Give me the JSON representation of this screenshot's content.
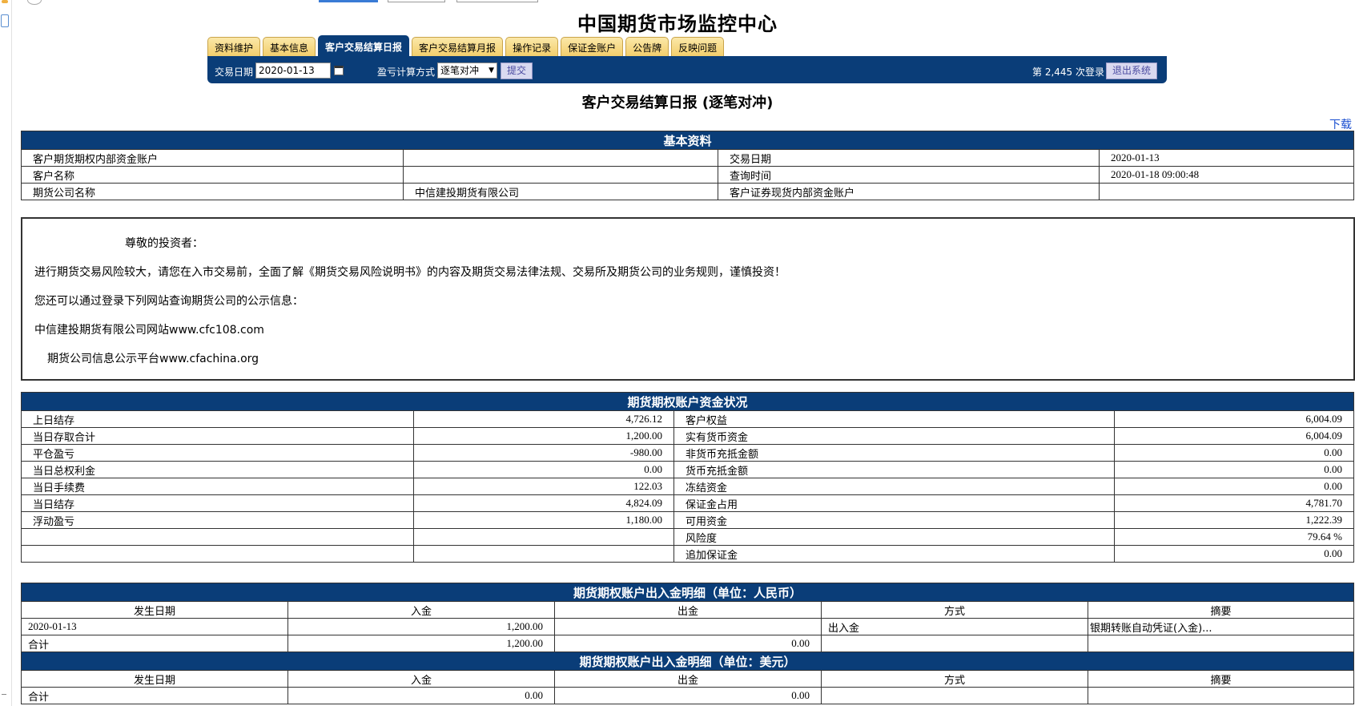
{
  "site_title": "中国期货市场监控中心",
  "tabs": [
    {
      "label": "资料维护",
      "active": false
    },
    {
      "label": "基本信息",
      "active": false
    },
    {
      "label": "客户交易结算日报",
      "active": true
    },
    {
      "label": "客户交易结算月报",
      "active": false
    },
    {
      "label": "操作记录",
      "active": false
    },
    {
      "label": "保证金账户",
      "active": false
    },
    {
      "label": "公告牌",
      "active": false
    },
    {
      "label": "反映问题",
      "active": false
    }
  ],
  "toolbar": {
    "date_label": "交易日期",
    "date_value": "2020-01-13",
    "method_label": "盈亏计算方式",
    "method_value": "逐笔对冲",
    "submit_label": "提交",
    "login_count": "第 2,445 次登录",
    "logout_label": "退出系统"
  },
  "report_title": "客户交易结算日报 (逐笔对冲)",
  "download_label": "下载",
  "basic_info": {
    "header": "基本资料",
    "rows": [
      {
        "l1": "客户期货期权内部资金账户",
        "v1": "",
        "l2": "交易日期",
        "v2": "2020-01-13"
      },
      {
        "l1": "客户名称",
        "v1": "",
        "l2": "查询时间",
        "v2": "2020-01-18 09:00:48"
      },
      {
        "l1": "期货公司名称",
        "v1": "中信建投期货有限公司",
        "l2": "客户证券现货内部资金账户",
        "v2": ""
      }
    ]
  },
  "notice": {
    "greeting": "尊敬的投资者：",
    "line1": "进行期货交易风险较大，请您在入市交易前，全面了解《期货交易风险说明书》的内容及期货交易法律法规、交易所及期货公司的业务规则，谨慎投资！",
    "line2": "您还可以通过登录下列网站查询期货公司的公示信息：",
    "line3": "中信建投期货有限公司网站www.cfc108.com",
    "line4": "期货公司信息公示平台www.cfachina.org"
  },
  "fund_status": {
    "header": "期货期权账户资金状况",
    "rows": [
      {
        "l1": "上日结存",
        "v1": "4,726.12",
        "l2": "客户权益",
        "v2": "6,004.09"
      },
      {
        "l1": "当日存取合计",
        "v1": "1,200.00",
        "l2": "实有货币资金",
        "v2": "6,004.09"
      },
      {
        "l1": "平仓盈亏",
        "v1": "-980.00",
        "l2": "非货币充抵金额",
        "v2": "0.00"
      },
      {
        "l1": "当日总权利金",
        "v1": "0.00",
        "l2": "货币充抵金额",
        "v2": "0.00"
      },
      {
        "l1": "当日手续费",
        "v1": "122.03",
        "l2": "冻结资金",
        "v2": "0.00"
      },
      {
        "l1": "当日结存",
        "v1": "4,824.09",
        "l2": "保证金占用",
        "v2": "4,781.70"
      },
      {
        "l1": "浮动盈亏",
        "v1": "1,180.00",
        "l2": "可用资金",
        "v2": "1,222.39"
      },
      {
        "l1": "",
        "v1": "",
        "l2": "风险度",
        "v2": "79.64 %"
      },
      {
        "l1": "",
        "v1": "",
        "l2": "追加保证金",
        "v2": "0.00"
      }
    ]
  },
  "rmb_flow": {
    "header": "期货期权账户出入金明细（单位：人民币）",
    "columns": [
      "发生日期",
      "入金",
      "出金",
      "方式",
      "摘要"
    ],
    "rows": [
      {
        "date": "2020-01-13",
        "in": "1,200.00",
        "out": "",
        "method": "出入金",
        "memo": "银期转账自动凭证(入金)..."
      },
      {
        "date": "合计",
        "in": "1,200.00",
        "out": "0.00",
        "method": "",
        "memo": ""
      }
    ]
  },
  "usd_flow": {
    "header": "期货期权账户出入金明细（单位：美元）",
    "columns": [
      "发生日期",
      "入金",
      "出金",
      "方式",
      "摘要"
    ],
    "rows": [
      {
        "date": "合计",
        "in": "0.00",
        "out": "0.00",
        "method": "",
        "memo": ""
      }
    ]
  },
  "colors": {
    "navy": "#0a3d78",
    "tab_gold": "#f2cd6a",
    "link_blue": "#1a4fd0"
  }
}
